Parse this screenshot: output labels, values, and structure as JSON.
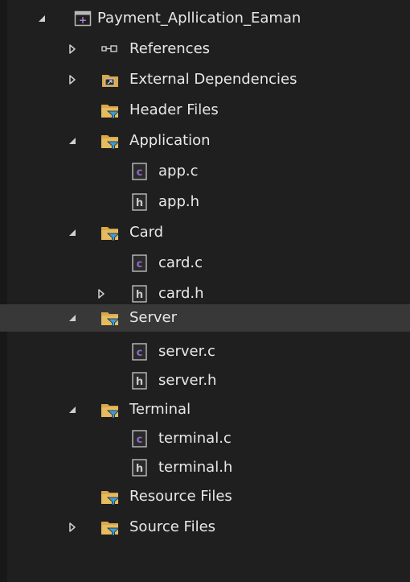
{
  "solution_explorer": {
    "project": {
      "label": "Payment_Apllication_Eaman",
      "icon": "project-icon",
      "expander": "expanded"
    },
    "items": [
      {
        "label": "References",
        "icon": "references-icon",
        "expander": "collapsed"
      },
      {
        "label": "External Dependencies",
        "icon": "external-dependencies-icon",
        "expander": "collapsed"
      },
      {
        "label": "Header Files",
        "icon": "filter-folder-icon",
        "expander": "none"
      },
      {
        "label": "Application",
        "icon": "filter-folder-icon",
        "expander": "expanded"
      },
      {
        "label": "app.c",
        "icon": "c-file-icon",
        "expander": "none"
      },
      {
        "label": "app.h",
        "icon": "h-file-icon",
        "expander": "none"
      },
      {
        "label": "Card",
        "icon": "filter-folder-icon",
        "expander": "expanded"
      },
      {
        "label": "card.c",
        "icon": "c-file-icon",
        "expander": "none"
      },
      {
        "label": "card.h",
        "icon": "h-file-icon",
        "expander": "collapsed"
      },
      {
        "label": "Server",
        "icon": "filter-folder-icon",
        "expander": "expanded",
        "selected": true
      },
      {
        "label": "server.c",
        "icon": "c-file-icon",
        "expander": "none"
      },
      {
        "label": "server.h",
        "icon": "h-file-icon",
        "expander": "none"
      },
      {
        "label": "Terminal",
        "icon": "filter-folder-icon",
        "expander": "expanded"
      },
      {
        "label": "terminal.c",
        "icon": "c-file-icon",
        "expander": "none"
      },
      {
        "label": "terminal.h",
        "icon": "h-file-icon",
        "expander": "none"
      },
      {
        "label": "Resource Files",
        "icon": "filter-folder-icon",
        "expander": "none"
      },
      {
        "label": "Source Files",
        "icon": "filter-folder-icon",
        "expander": "collapsed"
      }
    ]
  },
  "colors": {
    "background": "#1f1f1f",
    "selected_row": "#383838",
    "text": "#e8e8e8",
    "folder": "#d8a84a",
    "filter": "#3e9bd8",
    "c_file_accent": "#8e6cc8",
    "project_accent": "#b180d7"
  }
}
